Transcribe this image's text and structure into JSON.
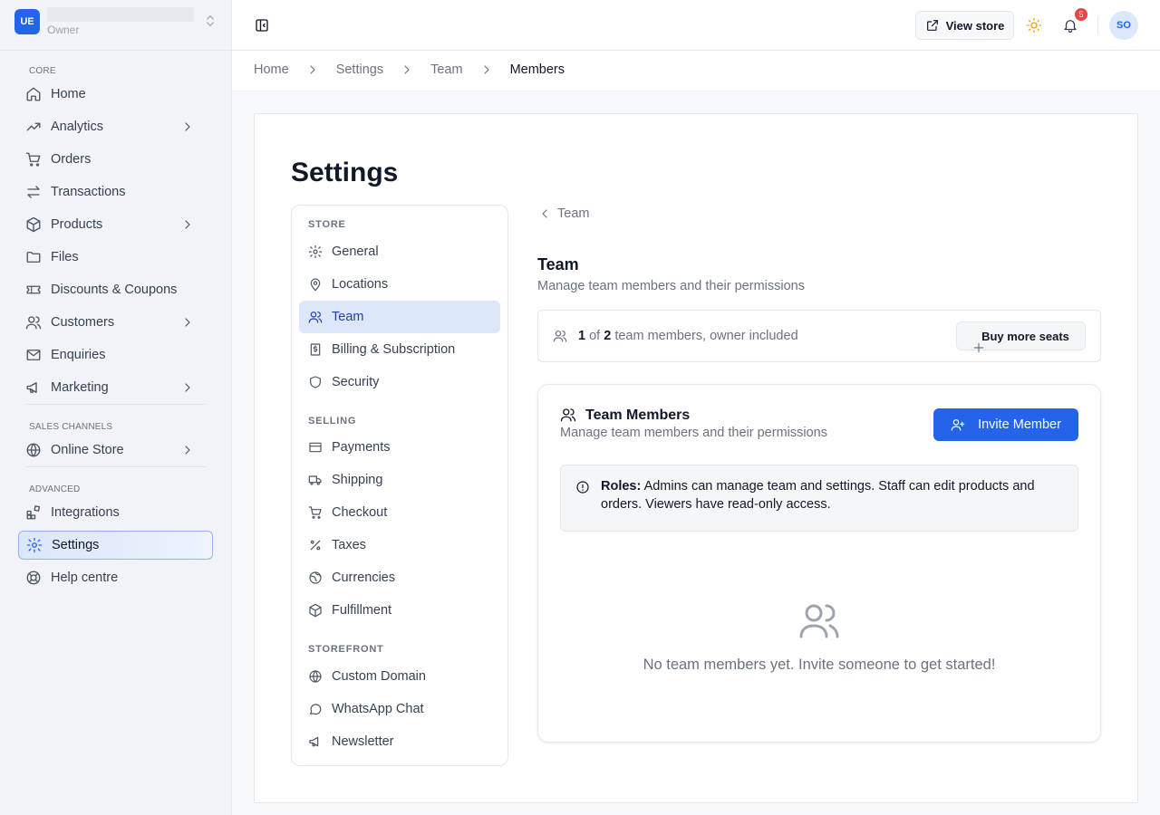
{
  "workspace": {
    "logo": "UE",
    "role": "Owner",
    "switch_icon": "chevrons-up-down-icon"
  },
  "sidebar": {
    "sections": [
      {
        "label": "CORE"
      },
      {
        "label": "SALES CHANNELS"
      },
      {
        "label": "ADVANCED"
      }
    ],
    "items": [
      {
        "label": "Home",
        "icon": "home-icon"
      },
      {
        "label": "Analytics",
        "icon": "trending-up-icon"
      },
      {
        "label": "Orders",
        "icon": "cart-icon"
      },
      {
        "label": "Transactions",
        "icon": "arrows-swap-icon"
      },
      {
        "label": "Products",
        "icon": "box-icon"
      },
      {
        "label": "Files",
        "icon": "folder-icon"
      },
      {
        "label": "Discounts & Coupons",
        "icon": "ticket-icon"
      },
      {
        "label": "Customers",
        "icon": "users-icon"
      },
      {
        "label": "Enquiries",
        "icon": "mail-icon"
      },
      {
        "label": "Marketing",
        "icon": "megaphone-icon"
      },
      {
        "label": "Online Store",
        "icon": "globe-icon"
      },
      {
        "label": "Integrations",
        "icon": "blocks-icon"
      },
      {
        "label": "Settings",
        "icon": "gear-icon",
        "active": true
      },
      {
        "label": "Help centre",
        "icon": "lifebuoy-icon"
      }
    ]
  },
  "topbar": {
    "view_store": "View store",
    "notification_count": "5",
    "avatar": "SO"
  },
  "breadcrumb": [
    "Home",
    "Settings",
    "Team",
    "Members"
  ],
  "page": {
    "title": "Settings"
  },
  "settings_nav": {
    "sections": [
      "STORE",
      "SELLING",
      "STOREFRONT"
    ],
    "items": [
      {
        "label": "General",
        "icon": "gear-icon"
      },
      {
        "label": "Locations",
        "icon": "map-pin-icon"
      },
      {
        "label": "Team",
        "icon": "users-icon",
        "active": true
      },
      {
        "label": "Billing & Subscription",
        "icon": "receipt-icon"
      },
      {
        "label": "Security",
        "icon": "shield-icon"
      },
      {
        "label": "Payments",
        "icon": "credit-card-icon"
      },
      {
        "label": "Shipping",
        "icon": "truck-icon"
      },
      {
        "label": "Checkout",
        "icon": "cart-icon"
      },
      {
        "label": "Taxes",
        "icon": "percent-icon"
      },
      {
        "label": "Currencies",
        "icon": "globe-icon"
      },
      {
        "label": "Fulfillment",
        "icon": "box-icon"
      },
      {
        "label": "Custom Domain",
        "icon": "globe-icon"
      },
      {
        "label": "WhatsApp Chat",
        "icon": "chat-icon"
      },
      {
        "label": "Newsletter",
        "icon": "megaphone-icon"
      }
    ]
  },
  "team": {
    "back_label": "Team",
    "title": "Team",
    "subtitle": "Manage team members and their permissions",
    "seats": {
      "used": "1",
      "of": "of",
      "total": "2",
      "suffix": "team members, owner included",
      "buy_label": "Buy more seats"
    },
    "members": {
      "title": "Team Members",
      "subtitle": "Manage team members and their permissions",
      "invite_label": "Invite Member",
      "roles_label": "Roles:",
      "roles_text": "Admins can manage team and settings. Staff can edit products and orders. Viewers have read-only access.",
      "empty_text": "No team members yet. Invite someone to get started!"
    }
  },
  "colors": {
    "accent": "#2563eb",
    "badge": "#ef4444",
    "sun": "#f59e0b"
  }
}
